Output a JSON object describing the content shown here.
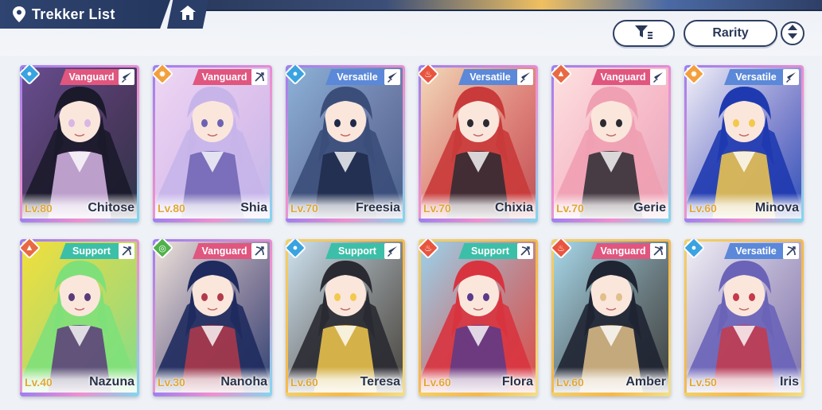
{
  "header": {
    "title": "Trekker List",
    "rarity_label": "Rarity"
  },
  "colors": {
    "vanguard": "#e0567f",
    "versatile": "#5b88d8",
    "support": "#3cbfa8",
    "element_water": "#3aa3e0",
    "element_light": "#f2a03c",
    "element_fire": "#e8553e",
    "element_earth": "#e86a42",
    "element_wind": "#4fb14a",
    "rarity_ssr": "#b889f0",
    "rarity_sr": "#f2c95a"
  },
  "cards": [
    {
      "name": "Chitose",
      "level": "Lv.80",
      "role": "Vanguard",
      "element": "water-icon",
      "weapon": "sword-icon",
      "rarity": "ssr",
      "palette": [
        "#1b1a2b",
        "#6a4e8f",
        "#d8b6e6"
      ]
    },
    {
      "name": "Shia",
      "level": "Lv.80",
      "role": "Vanguard",
      "element": "light-icon",
      "weapon": "bow-icon",
      "rarity": "ssr",
      "palette": [
        "#c7b5ea",
        "#f0d7f3",
        "#6d62b2"
      ]
    },
    {
      "name": "Freesia",
      "level": "Lv.70",
      "role": "Versatile",
      "element": "water-icon",
      "weapon": "sword-icon",
      "rarity": "ssr",
      "palette": [
        "#3b4e7a",
        "#8fb3d8",
        "#1f2a4a"
      ]
    },
    {
      "name": "Chixia",
      "level": "Lv.70",
      "role": "Versatile",
      "element": "fire-icon",
      "weapon": "sword-icon",
      "rarity": "ssr",
      "palette": [
        "#c93a3a",
        "#f3d9b8",
        "#2a2a33"
      ]
    },
    {
      "name": "Gerie",
      "level": "Lv.70",
      "role": "Vanguard",
      "element": "earth-icon",
      "weapon": "sword-icon",
      "rarity": "ssr",
      "palette": [
        "#f0a0b3",
        "#ffe2e0",
        "#2a2a30"
      ]
    },
    {
      "name": "Minova",
      "level": "Lv.60",
      "role": "Versatile",
      "element": "light-icon",
      "weapon": "sword-icon",
      "rarity": "ssr",
      "palette": [
        "#1f3ab0",
        "#f4f1f8",
        "#f2c94c"
      ]
    },
    {
      "name": "Nazuna",
      "level": "Lv.40",
      "role": "Support",
      "element": "earth-icon",
      "weapon": "bow-icon",
      "rarity": "ssr",
      "palette": [
        "#7fe07a",
        "#f5e03a",
        "#5a3a7a"
      ]
    },
    {
      "name": "Nanoha",
      "level": "Lv.30",
      "role": "Vanguard",
      "element": "wind-icon",
      "weapon": "bow-icon",
      "rarity": "ssr",
      "palette": [
        "#1f2b5e",
        "#f1e4dc",
        "#b23a4a"
      ]
    },
    {
      "name": "Teresa",
      "level": "Lv.60",
      "role": "Support",
      "element": "water-icon",
      "weapon": "sword-icon",
      "rarity": "sr",
      "palette": [
        "#2a2a32",
        "#cfe3f1",
        "#f2c94c"
      ]
    },
    {
      "name": "Flora",
      "level": "Lv.60",
      "role": "Support",
      "element": "fire-icon",
      "weapon": "bow-icon",
      "rarity": "sr",
      "palette": [
        "#d8343f",
        "#9ad3ec",
        "#5a3a8a"
      ]
    },
    {
      "name": "Amber",
      "level": "Lv.60",
      "role": "Vanguard",
      "element": "fire-icon",
      "weapon": "bow-icon",
      "rarity": "sr",
      "palette": [
        "#1f2432",
        "#a8d8ea",
        "#e0c08a"
      ]
    },
    {
      "name": "Iris",
      "level": "Lv.50",
      "role": "Versatile",
      "element": "water-icon",
      "weapon": "bow-icon",
      "rarity": "sr",
      "palette": [
        "#6a63b8",
        "#f2f0f6",
        "#c43a4a"
      ]
    }
  ]
}
